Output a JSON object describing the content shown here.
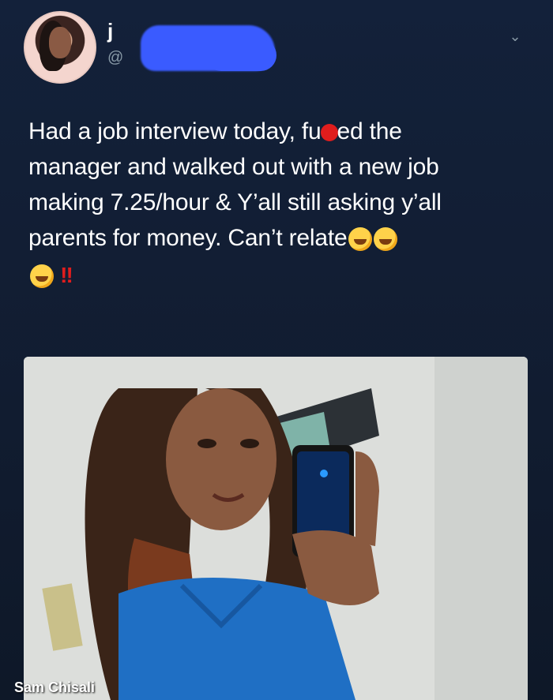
{
  "tweet": {
    "username_initial": "j",
    "handle_prefix": "@",
    "text_line1_a": "Had a job interview today, fu",
    "text_line1_b": "ed the",
    "text_line2": "manager and walked out with a new job",
    "text_line3": "making 7.25/hour & Y’all still asking y’all",
    "text_line4": "parents for money. Can’t relate",
    "exclamations": "!!",
    "icons": {
      "chevron": "chevron-down-icon",
      "emoji": "rolling-on-floor-laughing-emoji"
    }
  },
  "media": {
    "watermark": "Sam Chisali"
  },
  "colors": {
    "background": "#111c30",
    "text": "#ffffff",
    "muted": "#8899a6",
    "redaction": "#3a5bff",
    "censor": "#e01d1d"
  }
}
